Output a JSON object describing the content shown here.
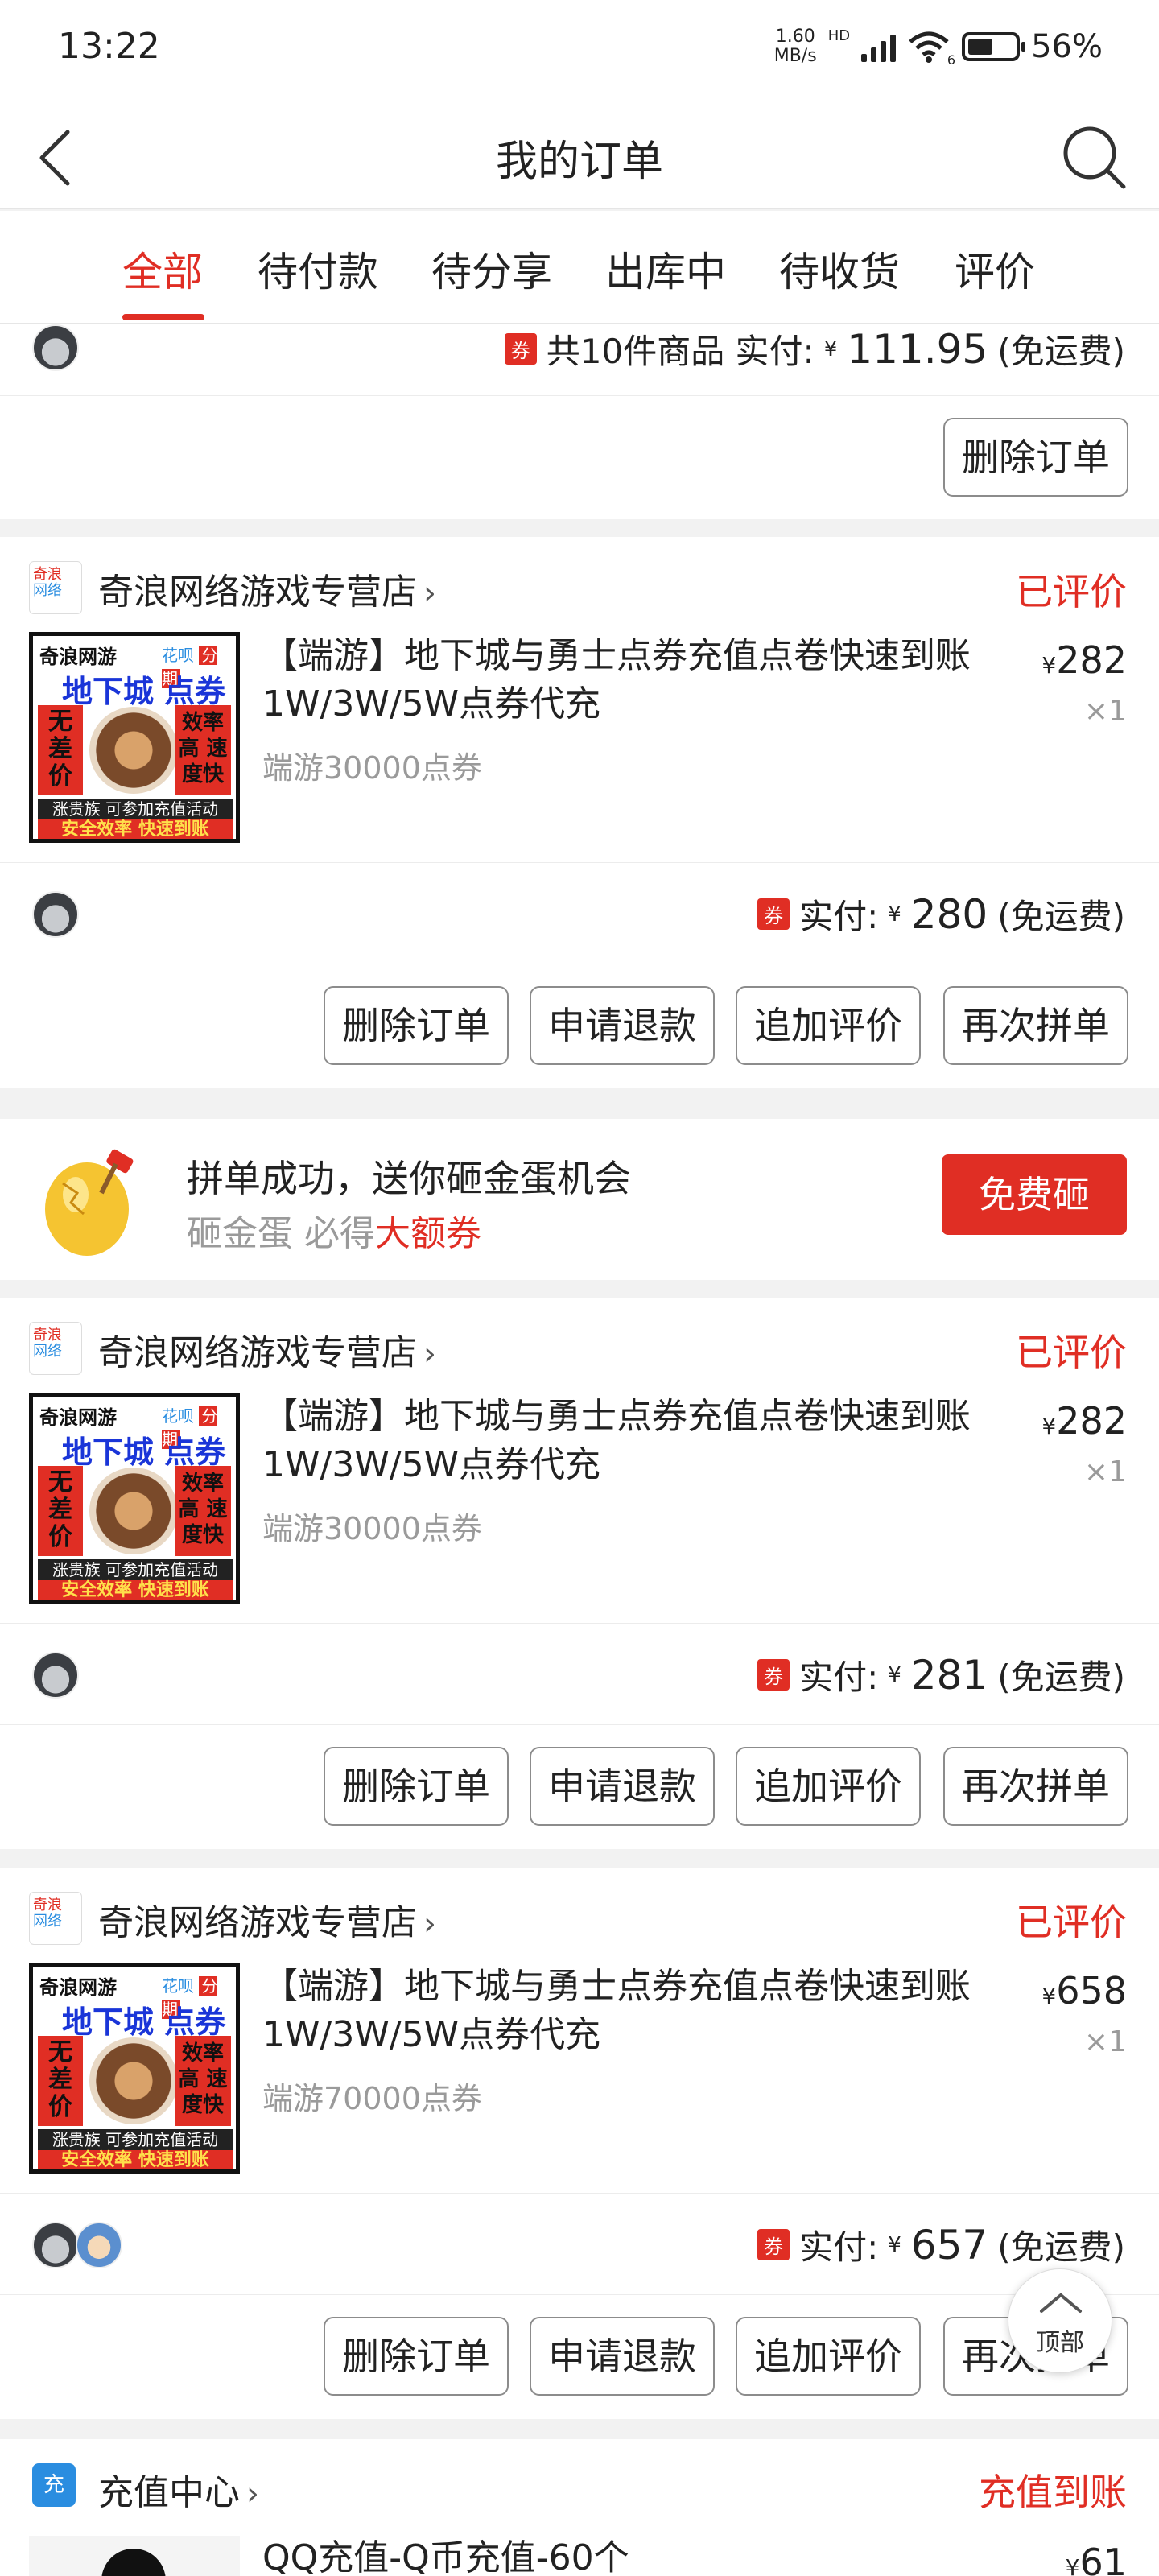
{
  "status_bar": {
    "time": "13:22",
    "network_speed_value": "1.60",
    "network_speed_unit": "MB/s",
    "network_type": "HD",
    "wifi_label": "6",
    "battery": "56%"
  },
  "nav": {
    "title": "我的订单"
  },
  "tabs": [
    {
      "label": "全部",
      "active": true
    },
    {
      "label": "待付款",
      "active": false
    },
    {
      "label": "待分享",
      "active": false
    },
    {
      "label": "出库中",
      "active": false
    },
    {
      "label": "待收货",
      "active": false
    },
    {
      "label": "评价",
      "active": false
    }
  ],
  "coupon_tag": "券",
  "partial_order": {
    "summary": "共10件商品 实付:",
    "yen": "¥",
    "amount": "111.95",
    "shipping": "(免运费)",
    "button": "删除订单"
  },
  "orders": [
    {
      "shop_logo_top": "奇浪",
      "shop_logo_bottom": "网络",
      "shop_name": "奇浪网络游戏专营店",
      "status": "已评价",
      "image": {
        "brand": "奇浪网游",
        "huabei": "花呗",
        "fenqi": "分期",
        "title": "地下城 点券",
        "left": "无差价",
        "right": "效率高 速度快",
        "bottom1": "涨贵族 可参加充值活动",
        "bottom2": "安全效率 快速到账"
      },
      "title": "【端游】地下城与勇士点券充值点卷快速到账1W/3W/5W点券代充",
      "spec": "端游30000点券",
      "price_yen": "¥",
      "price": "282",
      "qty": "×1",
      "paid_label": "实付:",
      "paid_yen": "¥",
      "paid": "280",
      "shipping": "(免运费)",
      "buttons": [
        "删除订单",
        "申请退款",
        "追加评价",
        "再次拼单"
      ]
    },
    {
      "shop_logo_top": "奇浪",
      "shop_logo_bottom": "网络",
      "shop_name": "奇浪网络游戏专营店",
      "status": "已评价",
      "image": {
        "brand": "奇浪网游",
        "huabei": "花呗",
        "fenqi": "分期",
        "title": "地下城 点券",
        "left": "无差价",
        "right": "效率高 速度快",
        "bottom1": "涨贵族 可参加充值活动",
        "bottom2": "安全效率 快速到账"
      },
      "title": "【端游】地下城与勇士点券充值点卷快速到账1W/3W/5W点券代充",
      "spec": "端游30000点券",
      "price_yen": "¥",
      "price": "282",
      "qty": "×1",
      "paid_label": "实付:",
      "paid_yen": "¥",
      "paid": "281",
      "shipping": "(免运费)",
      "buttons": [
        "删除订单",
        "申请退款",
        "追加评价",
        "再次拼单"
      ]
    },
    {
      "shop_logo_top": "奇浪",
      "shop_logo_bottom": "网络",
      "shop_name": "奇浪网络游戏专营店",
      "status": "已评价",
      "image": {
        "brand": "奇浪网游",
        "huabei": "花呗",
        "fenqi": "分期",
        "title": "地下城 点券",
        "left": "无差价",
        "right": "效率高 速度快",
        "bottom1": "涨贵族 可参加充值活动",
        "bottom2": "安全效率 快速到账"
      },
      "title": "【端游】地下城与勇士点券充值点卷快速到账1W/3W/5W点券代充",
      "spec": "端游70000点券",
      "price_yen": "¥",
      "price": "658",
      "qty": "×1",
      "paid_label": "实付:",
      "paid_yen": "¥",
      "paid": "657",
      "shipping": "(免运费)",
      "buttons": [
        "删除订单",
        "申请退款",
        "追加评价",
        "再次拼单"
      ]
    }
  ],
  "promo": {
    "line1": "拼单成功，送你砸金蛋机会",
    "line2_prefix": "砸金蛋 必得",
    "line2_highlight": "大额券",
    "button": "免费砸"
  },
  "recharge": {
    "icon_label": "充",
    "shop_name": "充值中心",
    "status": "充值到账",
    "title": "QQ充值-Q币充值-60个",
    "price_yen": "¥",
    "price": "61"
  },
  "back_to_top": "顶部",
  "colors": {
    "accent": "#e02e24",
    "background": "#f2f2f2",
    "muted_text": "#9a9a9a"
  },
  "icons": [
    "back-arrow-icon",
    "search-icon",
    "signal-icon",
    "wifi-icon",
    "battery-icon",
    "chevron-right-icon",
    "golden-egg-icon",
    "chevron-up-icon"
  ]
}
